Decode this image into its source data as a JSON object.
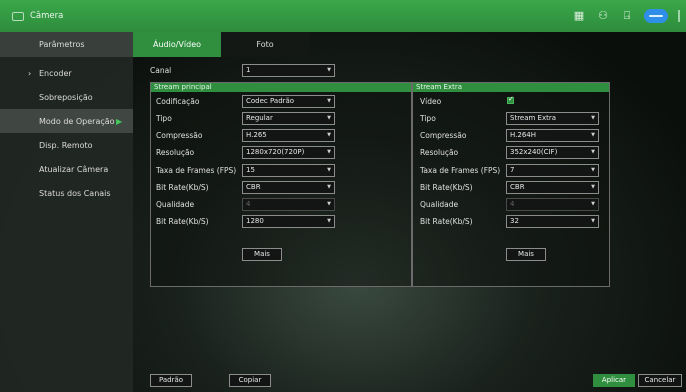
{
  "window": {
    "title": "Câmera",
    "icon": "camera-icon"
  },
  "toolbar": {
    "icons": [
      "calendar-icon",
      "users-icon",
      "exit-icon",
      "cloud-icon",
      "close-icon"
    ]
  },
  "sidebar": {
    "items": [
      {
        "label": "Parâmetros"
      },
      {
        "label": "Encoder"
      },
      {
        "label": "Sobreposição"
      },
      {
        "label": "Modo de Operação"
      },
      {
        "label": "Disp. Remoto"
      },
      {
        "label": "Atualizar Câmera"
      },
      {
        "label": "Status dos Canais"
      }
    ]
  },
  "tabs": [
    {
      "label": "Áudio/Vídeo"
    },
    {
      "label": "Foto"
    }
  ],
  "canal": {
    "label": "Canal",
    "value": "1"
  },
  "main_stream": {
    "title": "Stream principal",
    "rows": [
      {
        "label": "Codificação",
        "value": "Codec Padrão"
      },
      {
        "label": "Tipo",
        "value": "Regular"
      },
      {
        "label": "Compressão",
        "value": "H.265"
      },
      {
        "label": "Resolução",
        "value": "1280x720(720P)"
      },
      {
        "label": "Taxa de Frames (FPS)",
        "value": "15"
      },
      {
        "label": "Bit Rate(Kb/S)",
        "value": "CBR"
      },
      {
        "label": "Qualidade",
        "value": "4"
      },
      {
        "label": "Bit Rate(Kb/S)",
        "value": "1280"
      }
    ],
    "more_label": "Mais"
  },
  "extra_stream": {
    "title": "Stream Extra",
    "rows": [
      {
        "label": "Vídeo",
        "value": ""
      },
      {
        "label": "Tipo",
        "value": "Stream Extra"
      },
      {
        "label": "Compressão",
        "value": "H.264H"
      },
      {
        "label": "Resolução",
        "value": "352x240(CIF)"
      },
      {
        "label": "Taxa de Frames (FPS)",
        "value": "7"
      },
      {
        "label": "Bit Rate(Kb/S)",
        "value": "CBR"
      },
      {
        "label": "Qualidade",
        "value": "4"
      },
      {
        "label": "Bit Rate(Kb/S)",
        "value": "32"
      }
    ],
    "more_label": "Mais"
  },
  "footer": {
    "default_label": "Padrão",
    "copy_label": "Copiar",
    "apply_label": "Aplicar",
    "cancel_label": "Cancelar"
  },
  "colors": {
    "accent": "#2f8f3f",
    "titlebar": "#3aa84a"
  }
}
